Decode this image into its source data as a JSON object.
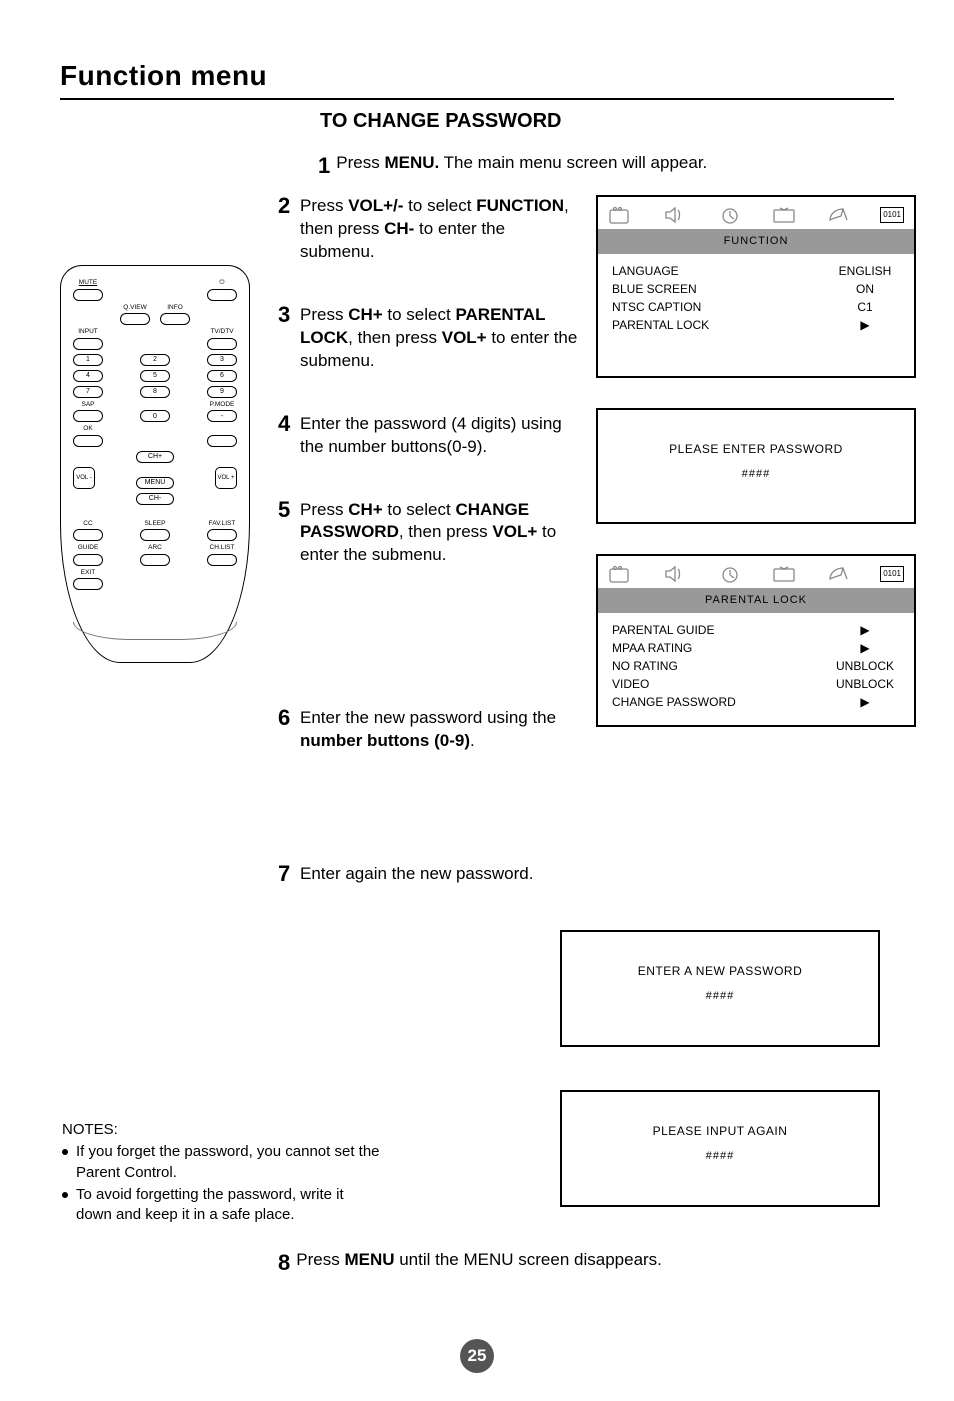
{
  "page": {
    "title": "Function menu",
    "section": "TO CHANGE PASSWORD",
    "page_number": "25"
  },
  "steps": {
    "s1": {
      "num": "1",
      "text_a": "Press ",
      "b1": "MENU.",
      "text_b": " The main menu screen will appear."
    },
    "s2": {
      "num": "2",
      "text_a": "Press ",
      "b1": "VOL+/-",
      "text_b": " to select ",
      "b2": "FUNCTION",
      "text_c": ", then press ",
      "b3": "CH-",
      "text_d": " to enter the submenu."
    },
    "s3": {
      "num": "3",
      "text_a": "Press ",
      "b1": "CH+",
      "text_b": " to select ",
      "b2": "PARENTAL LOCK",
      "text_c": ", then press ",
      "b3": "VOL+",
      "text_d": " to enter the submenu."
    },
    "s4": {
      "num": "4",
      "text_a": "Enter the password (4 digits) using the number buttons(0-9)."
    },
    "s5": {
      "num": "5",
      "text_a": "Press ",
      "b1": "CH+",
      "text_b": " to select ",
      "b2": "CHANGE PASSWORD",
      "text_c": ", then press ",
      "b3": "VOL+",
      "text_d": " to enter the submenu."
    },
    "s6": {
      "num": "6",
      "text_a": "Enter the new password using the ",
      "b1": "number buttons (0-9)",
      "text_b": "."
    },
    "s7": {
      "num": "7",
      "text_a": "Enter again the new password."
    },
    "s8": {
      "num": "8",
      "text_a": "Press ",
      "b1": "MENU",
      "text_b": " until the MENU screen disappears."
    }
  },
  "osd": {
    "function": {
      "code": "0101",
      "bar": "FUNCTION",
      "rows": [
        {
          "k": "LANGUAGE",
          "v": "ENGLISH"
        },
        {
          "k": "BLUE SCREEN",
          "v": "ON"
        },
        {
          "k": "NTSC CAPTION",
          "v": "C1"
        },
        {
          "k": "PARENTAL LOCK",
          "v": "▶"
        }
      ]
    },
    "password": {
      "msg": "PLEASE ENTER PASSWORD",
      "hash": "####"
    },
    "parental": {
      "code": "0101",
      "bar": "PARENTAL LOCK",
      "rows": [
        {
          "k": "PARENTAL GUIDE",
          "v": "▶"
        },
        {
          "k": "MPAA RATING",
          "v": "▶"
        },
        {
          "k": "NO RATING",
          "v": "UNBLOCK"
        },
        {
          "k": "VIDEO",
          "v": "UNBLOCK"
        },
        {
          "k": "CHANGE PASSWORD",
          "v": "▶"
        }
      ]
    },
    "newpass": {
      "msg": "ENTER A NEW PASSWORD",
      "hash": "####"
    },
    "again": {
      "msg": "PLEASE INPUT AGAIN",
      "hash": "####"
    }
  },
  "remote": {
    "mute": "MUTE",
    "power": "⏻",
    "qview": "Q.VIEW",
    "info": "INFO",
    "input": "INPUT",
    "tvdtv": "TV/DTV",
    "n1": "1",
    "n2": "2",
    "n3": "3",
    "n4": "4",
    "n5": "5",
    "n6": "6",
    "n7": "7",
    "n8": "8",
    "n9": "9",
    "n0": "0",
    "sap": "SAP",
    "pmode": "P.MODE",
    "dash": "-",
    "ok": "OK",
    "chp": "CH+",
    "chm": "CH-",
    "volm": "VOL\n-",
    "volp": "VOL\n+",
    "menu": "MENU",
    "cc": "CC",
    "sleep": "SLEEP",
    "favlist": "FAV.LIST",
    "guide": "GUIDE",
    "arc": "ARC",
    "chlist": "CH.LIST",
    "exit": "EXIT"
  },
  "notes": {
    "hdr": "NOTES:",
    "n1": "If you forget the password, you cannot set the Parent Control.",
    "n2": "To avoid forgetting the password, write it down and keep it in a safe place."
  }
}
